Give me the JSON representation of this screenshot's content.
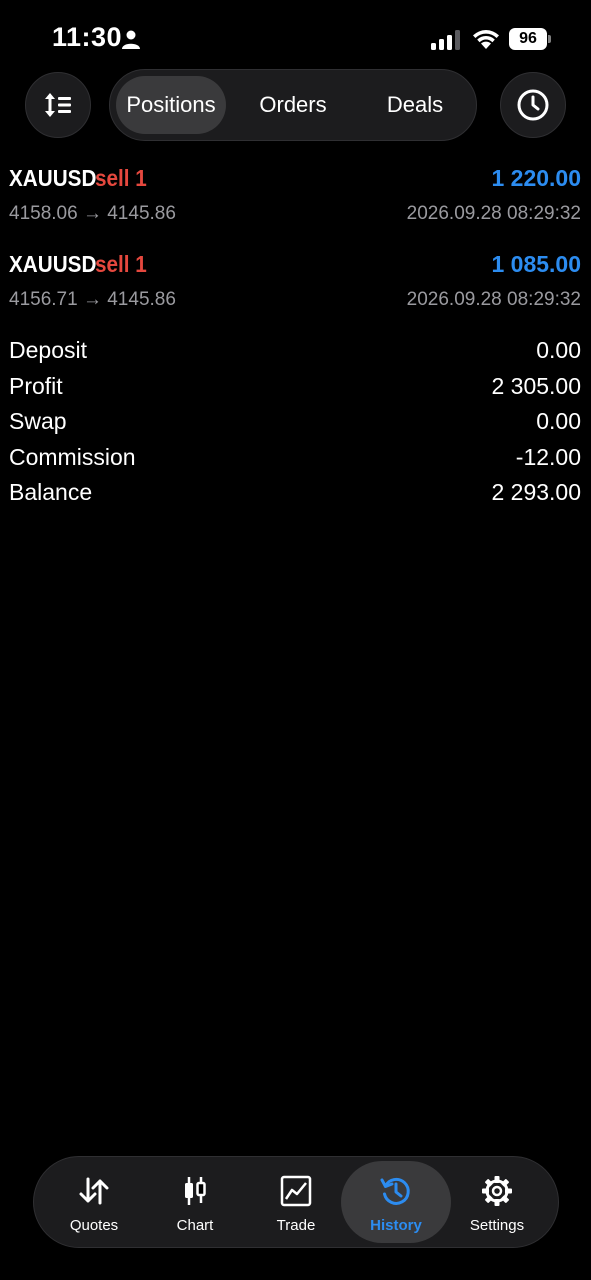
{
  "status_bar": {
    "time": "11:30",
    "battery": "96",
    "icons": [
      "person-icon",
      "cellular-signal-icon",
      "wifi-icon",
      "battery-icon"
    ]
  },
  "top_bar": {
    "left_button_icon": "sort-icon",
    "right_button_icon": "clock-icon",
    "tabs": [
      {
        "label": "Positions",
        "active": true
      },
      {
        "label": "Orders",
        "active": false
      },
      {
        "label": "Deals",
        "active": false
      }
    ]
  },
  "deals": [
    {
      "symbol": "XAUUSD",
      "side": "sell 1",
      "profit": "1 220.00",
      "prices": "4158.06 → 4145.86",
      "time": "2026.09.28 08:29:32"
    },
    {
      "symbol": "XAUUSD",
      "side": "sell 1",
      "profit": "1 085.00",
      "prices": "4156.71 → 4145.86",
      "time": "2026.09.28 08:29:32"
    }
  ],
  "summary": [
    {
      "label": "Deposit",
      "value": "0.00"
    },
    {
      "label": "Profit",
      "value": "2 305.00"
    },
    {
      "label": "Swap",
      "value": "0.00"
    },
    {
      "label": "Commission",
      "value": "-12.00"
    },
    {
      "label": "Balance",
      "value": "2 293.00"
    }
  ],
  "tab_bar": [
    {
      "label": "Quotes",
      "icon": "quotes-arrows-icon",
      "active": false
    },
    {
      "label": "Chart",
      "icon": "candlestick-icon",
      "active": false
    },
    {
      "label": "Trade",
      "icon": "trade-chart-icon",
      "active": false
    },
    {
      "label": "History",
      "icon": "history-icon",
      "active": true
    },
    {
      "label": "Settings",
      "icon": "gear-icon",
      "active": false
    }
  ],
  "colors": {
    "background": "#000000",
    "sell": "#e5483e",
    "profit": "#2c8cf0",
    "accent": "#2c8cf0",
    "muted": "#9a9a9f"
  }
}
